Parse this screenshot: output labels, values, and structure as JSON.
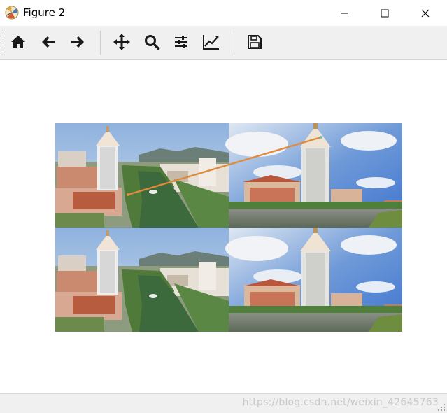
{
  "window": {
    "title": "Figure 2",
    "controls": [
      "minimize",
      "maximize",
      "close"
    ]
  },
  "toolbar": {
    "buttons": [
      {
        "name": "home",
        "icon": "home-icon"
      },
      {
        "name": "back",
        "icon": "arrow-left-icon"
      },
      {
        "name": "forward",
        "icon": "arrow-right-icon"
      },
      {
        "name": "pan",
        "icon": "move-icon"
      },
      {
        "name": "zoom",
        "icon": "magnifier-icon"
      },
      {
        "name": "configure-subplots",
        "icon": "sliders-icon"
      },
      {
        "name": "edit-axis",
        "icon": "chart-line-icon"
      },
      {
        "name": "save",
        "icon": "floppy-disk-icon"
      }
    ]
  },
  "figure": {
    "panels": [
      {
        "position": "top-left",
        "content": "aerial view of tower beside river"
      },
      {
        "position": "top-right",
        "content": "tower across lake under blue sky"
      },
      {
        "position": "bottom-left",
        "content": "aerial view of tower beside river"
      },
      {
        "position": "bottom-right",
        "content": "tower across lake under blue sky"
      }
    ],
    "match_line_color": "#e08a3c"
  },
  "status": {
    "message": "",
    "watermark": "https://blog.csdn.net/weixin_42645763"
  },
  "colors": {
    "toolbar_bg": "#f0f0f0",
    "icon": "#1a1a1a",
    "sky": "#5b8fd6",
    "river": "#3f6b3a"
  }
}
